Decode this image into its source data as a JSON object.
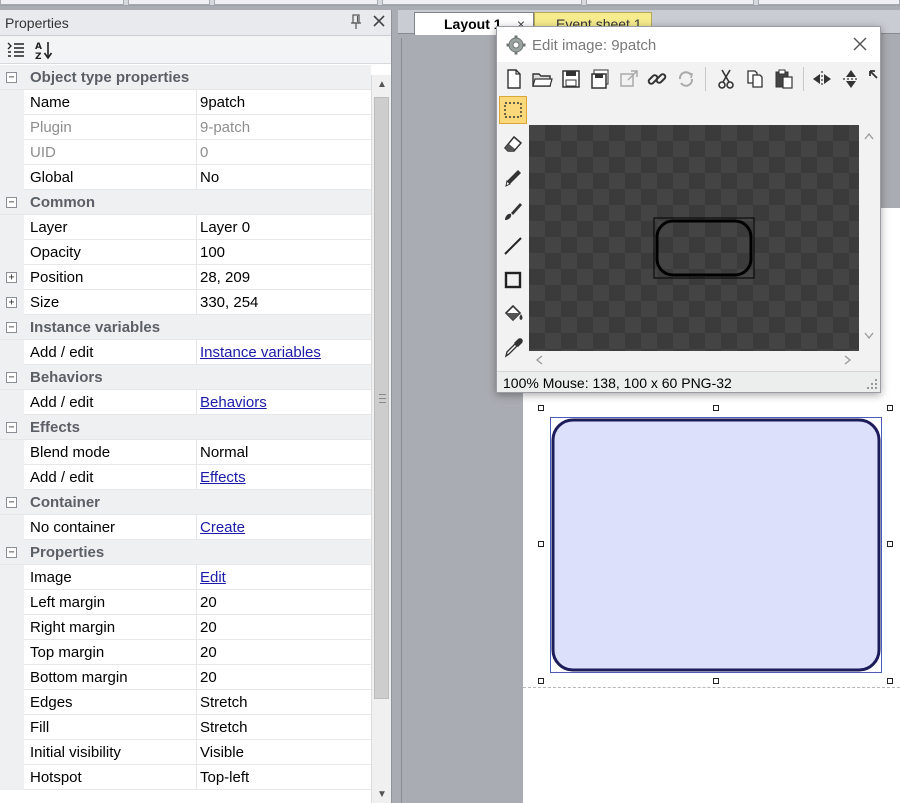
{
  "properties_panel": {
    "title": "Properties",
    "pin_icon": "pin-icon",
    "close_icon": "close-icon",
    "rows": [
      {
        "type": "category",
        "label": "Object type properties",
        "toggle": "−"
      },
      {
        "type": "prop",
        "name": "Name",
        "value": "9patch"
      },
      {
        "type": "prop",
        "name": "Plugin",
        "value": "9-patch",
        "disabled": true
      },
      {
        "type": "prop",
        "name": "UID",
        "value": "0",
        "disabled": true
      },
      {
        "type": "prop",
        "name": "Global",
        "value": "No"
      },
      {
        "type": "category",
        "label": "Common",
        "toggle": "−"
      },
      {
        "type": "prop",
        "name": "Layer",
        "value": "Layer 0"
      },
      {
        "type": "prop",
        "name": "Opacity",
        "value": "100"
      },
      {
        "type": "prop",
        "name": "Position",
        "value": "28, 209",
        "toggle": "+"
      },
      {
        "type": "prop",
        "name": "Size",
        "value": "330, 254",
        "toggle": "+"
      },
      {
        "type": "category",
        "label": "Instance variables",
        "toggle": "−"
      },
      {
        "type": "prop",
        "name": "Add / edit",
        "value": "Instance variables",
        "link": true
      },
      {
        "type": "category",
        "label": "Behaviors",
        "toggle": "−"
      },
      {
        "type": "prop",
        "name": "Add / edit",
        "value": "Behaviors",
        "link": true
      },
      {
        "type": "category",
        "label": "Effects",
        "toggle": "−"
      },
      {
        "type": "prop",
        "name": "Blend mode",
        "value": "Normal"
      },
      {
        "type": "prop",
        "name": "Add / edit",
        "value": "Effects",
        "link": true
      },
      {
        "type": "category",
        "label": "Container",
        "toggle": "−"
      },
      {
        "type": "prop",
        "name": "No container",
        "value": "Create",
        "link": true
      },
      {
        "type": "category",
        "label": "Properties",
        "toggle": "−"
      },
      {
        "type": "prop",
        "name": "Image",
        "value": "Edit",
        "link": true
      },
      {
        "type": "prop",
        "name": "Left margin",
        "value": "20"
      },
      {
        "type": "prop",
        "name": "Right margin",
        "value": "20"
      },
      {
        "type": "prop",
        "name": "Top margin",
        "value": "20"
      },
      {
        "type": "prop",
        "name": "Bottom margin",
        "value": "20"
      },
      {
        "type": "prop",
        "name": "Edges",
        "value": "Stretch"
      },
      {
        "type": "prop",
        "name": "Fill",
        "value": "Stretch"
      },
      {
        "type": "prop",
        "name": "Initial visibility",
        "value": "Visible"
      },
      {
        "type": "prop",
        "name": "Hotspot",
        "value": "Top-left"
      }
    ]
  },
  "tabs": {
    "layout": "Layout 1",
    "layout_close": "×",
    "event_sheet": "Event sheet 1"
  },
  "dialog": {
    "title": "Edit image: 9patch",
    "close": "×",
    "status": "100%  Mouse: 138,  100 x 60  PNG-32"
  },
  "colors": {
    "nine_patch_fill": "#dde0fb",
    "nine_patch_border": "#1c1c5a",
    "link": "#1b1ba8",
    "selected_tool": "#fbd97b"
  }
}
